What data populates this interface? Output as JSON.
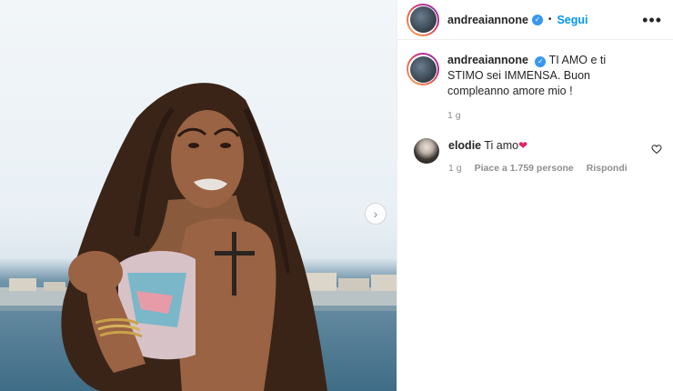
{
  "post": {
    "author": "andreaiannone",
    "follow_label": "Segui",
    "separator": "•",
    "more_label": "•••",
    "caption_author": "andreaiannone",
    "caption_text": "TI AMO e ti STIMO sei IMMENSA. Buon compleanno amore mio !",
    "caption_time": "1 g"
  },
  "comments": [
    {
      "author": "elodie",
      "text": "Ti amo",
      "emoji": "❤",
      "time": "1 g",
      "likes": "Piace a 1.759 persone",
      "reply": "Rispondi"
    }
  ],
  "icons": {
    "verified": "verified-badge-icon",
    "next": "chevron-right-icon",
    "like": "heart-outline-icon"
  },
  "colors": {
    "accent": "#0095f6",
    "verified": "#3897f0",
    "heart": "#e0245e"
  }
}
